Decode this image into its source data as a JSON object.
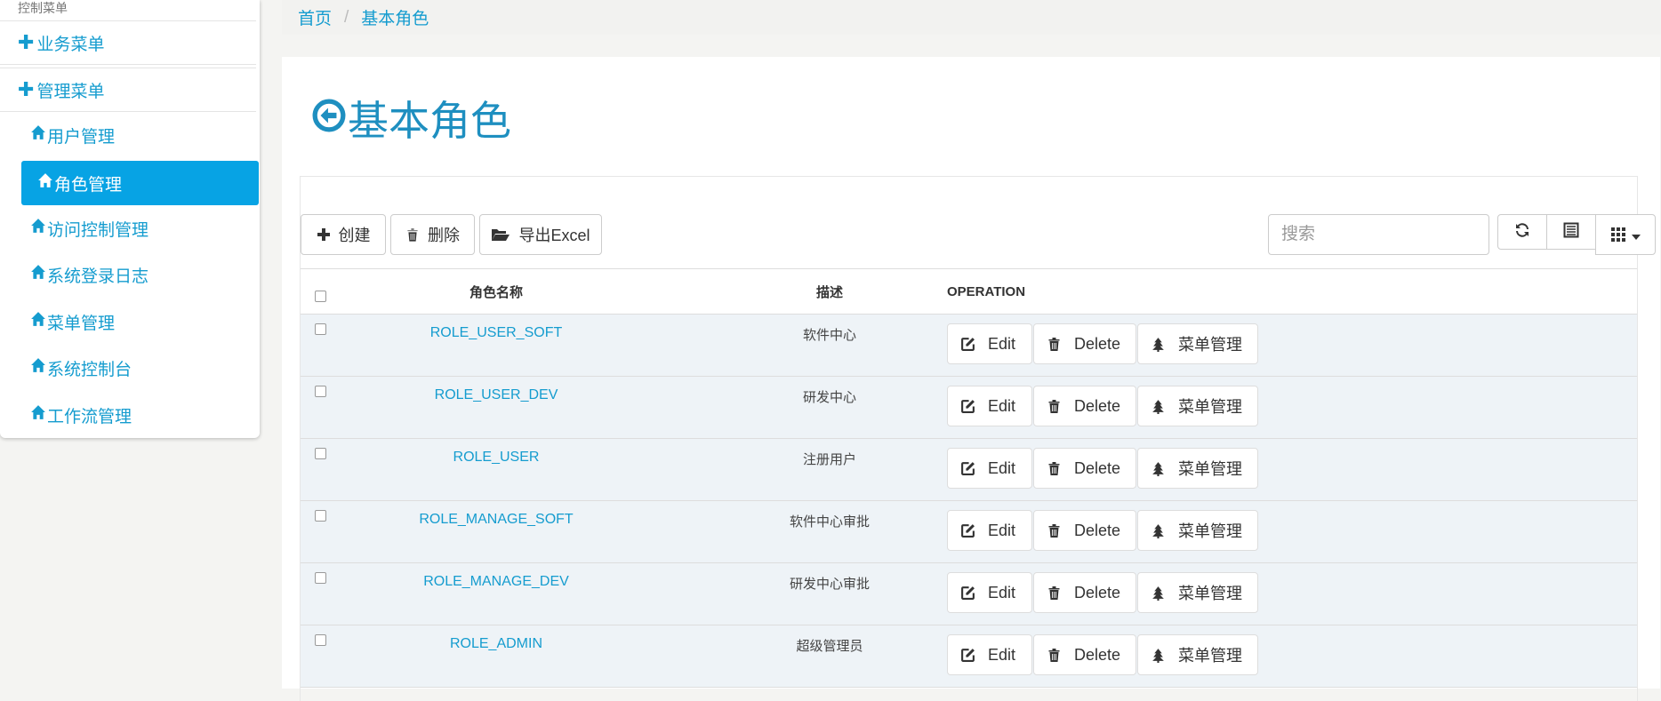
{
  "sidebar": {
    "caption": "控制菜单",
    "groups": [
      {
        "label": "业务菜单"
      },
      {
        "label": "管理菜单"
      }
    ],
    "items": [
      {
        "label": "用户管理"
      },
      {
        "label": "角色管理"
      },
      {
        "label": "访问控制管理"
      },
      {
        "label": "系统登录日志"
      },
      {
        "label": "菜单管理"
      },
      {
        "label": "系统控制台"
      },
      {
        "label": "工作流管理"
      }
    ],
    "active_item": "角色管理"
  },
  "breadcrumb": {
    "home": "首页",
    "separator": "/",
    "current": "基本角色"
  },
  "page": {
    "title": "基本角色"
  },
  "toolbar": {
    "create_label": "创建",
    "delete_label": "删除",
    "export_label": "导出Excel",
    "search_placeholder": "搜索"
  },
  "table": {
    "headers": {
      "name": "角色名称",
      "desc": "描述",
      "operation": "OPERATION"
    },
    "rows": [
      {
        "name": "ROLE_USER_SOFT",
        "desc": "软件中心"
      },
      {
        "name": "ROLE_USER_DEV",
        "desc": "研发中心"
      },
      {
        "name": "ROLE_USER",
        "desc": "注册用户"
      },
      {
        "name": "ROLE_MANAGE_SOFT",
        "desc": "软件中心审批"
      },
      {
        "name": "ROLE_MANAGE_DEV",
        "desc": "研发中心审批"
      },
      {
        "name": "ROLE_ADMIN",
        "desc": "超级管理员"
      }
    ],
    "row_actions": {
      "edit": "Edit",
      "delete": "Delete",
      "menu": "菜单管理"
    }
  },
  "colors": {
    "accent": "#159ccf",
    "active_bg": "#07a3e4",
    "row_bg": "#eef3f7",
    "title": "#1e8fc0"
  }
}
